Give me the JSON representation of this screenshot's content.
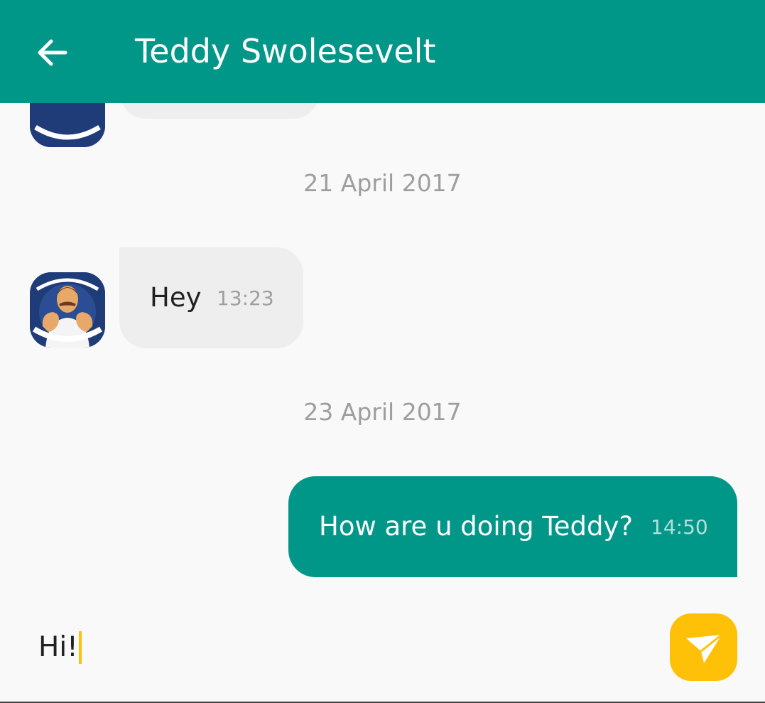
{
  "header": {
    "title": "Teddy Swolesevelt",
    "back_icon": "arrow-left-icon"
  },
  "messages": {
    "date_1": "21 April 2017",
    "incoming": {
      "text": "Hey",
      "time": "13:23"
    },
    "date_2": "23 April 2017",
    "outgoing": {
      "text": "How are u doing Teddy?",
      "time": "14:50"
    }
  },
  "composer": {
    "value": "Hi!",
    "send_icon": "paper-plane-icon"
  },
  "colors": {
    "primary": "#009688",
    "accent": "#ffc107",
    "incoming_bubble": "#eeeeee",
    "background": "#f9f9f9",
    "date_text": "#9e9e9e"
  }
}
